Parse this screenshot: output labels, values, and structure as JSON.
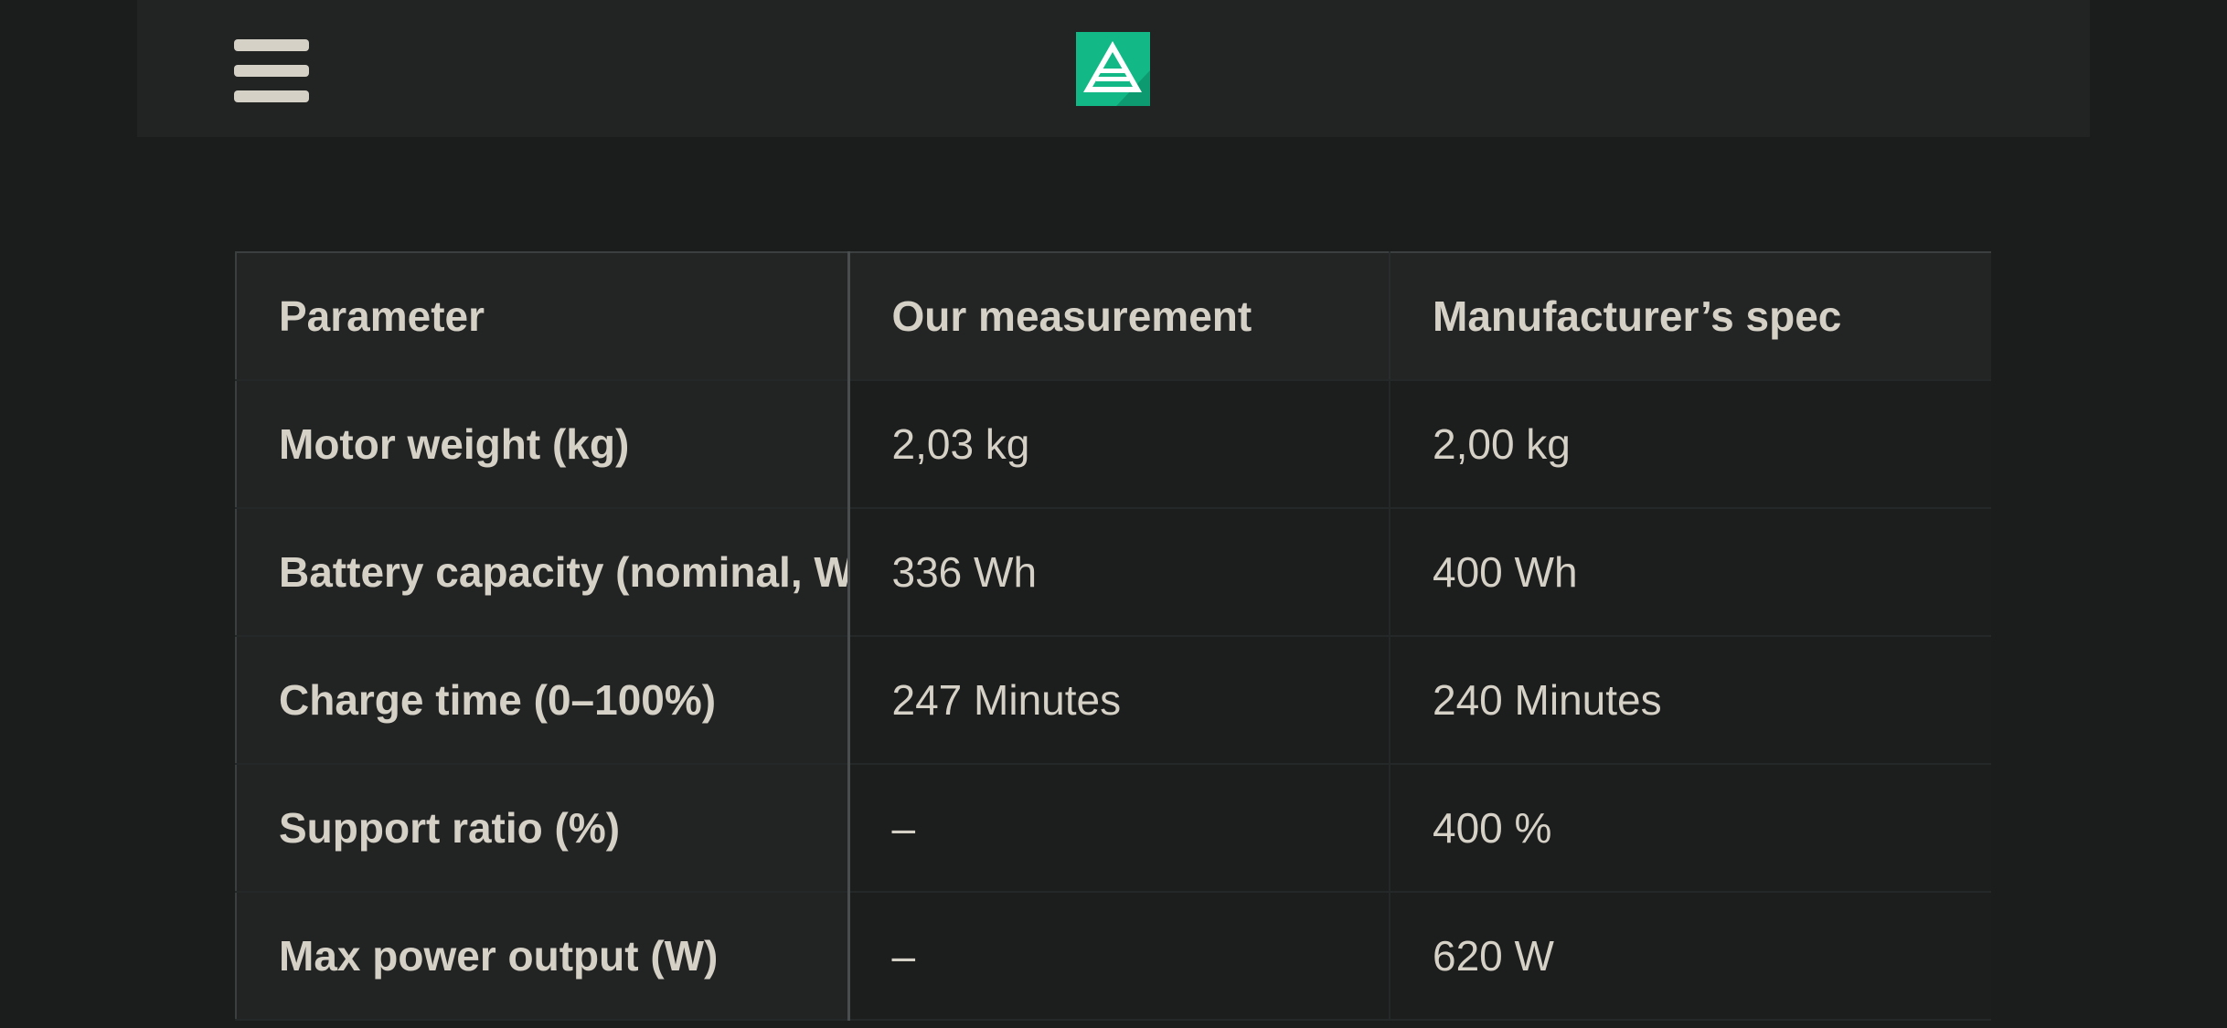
{
  "header": {
    "menu_icon": "hamburger-menu-icon",
    "logo_icon": "brand-logo-icon",
    "logo_color": "#12b886"
  },
  "table": {
    "columns": [
      "Parameter",
      "Our measurement",
      "Manufacturer’s spec"
    ],
    "rows": [
      {
        "parameter": "Motor weight (kg)",
        "measured": "2,03 kg",
        "spec": "2,00 kg"
      },
      {
        "parameter": "Battery capacity (nominal, Wh)",
        "measured": "336 Wh",
        "spec": "400 Wh"
      },
      {
        "parameter": "Charge time (0–100%)",
        "measured": "247 Minutes",
        "spec": "240 Minutes"
      },
      {
        "parameter": "Support ratio (%)",
        "measured": "–",
        "spec": "400 %"
      },
      {
        "parameter": "Max power output (W)",
        "measured": "–",
        "spec": "620 W"
      }
    ]
  }
}
